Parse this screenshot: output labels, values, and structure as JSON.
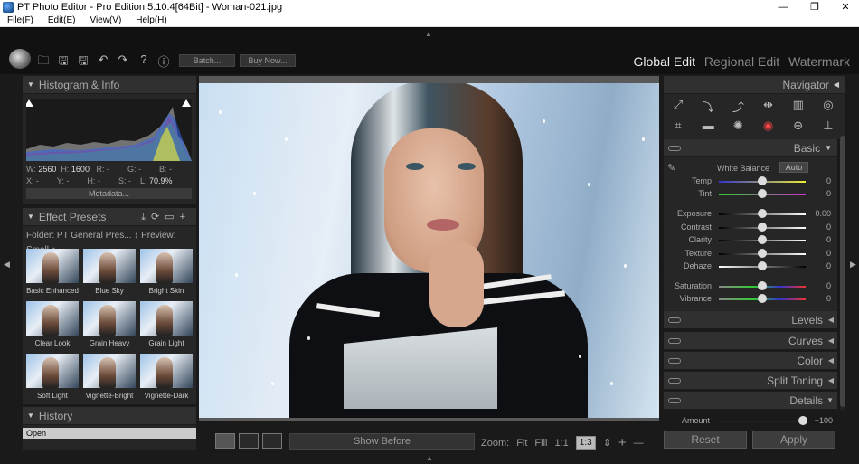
{
  "titlebar": {
    "title": "PT Photo Editor - Pro Edition 5.10.4[64Bit] - Woman-021.jpg",
    "min": "—",
    "max": "❐",
    "close": "✕"
  },
  "menu": [
    "File(F)",
    "Edit(E)",
    "View(V)",
    "Help(H)"
  ],
  "toolbar": {
    "batch_label": "Batch...",
    "buy_label": "Buy Now..."
  },
  "modes": {
    "global": "Global Edit",
    "regional": "Regional Edit",
    "watermark": "Watermark"
  },
  "histogram": {
    "title": "Histogram & Info",
    "w_label": "W:",
    "w": "2560",
    "h_label": "H:",
    "h": "1600",
    "r": "R:",
    "r_val": "-",
    "g": "G:",
    "g_val": "-",
    "b": "B:",
    "b_val": "-",
    "x": "X:",
    "x_val": "-",
    "y": "Y:",
    "y_val": "-",
    "hh": "H:",
    "hh_val": "-",
    "s": "S:",
    "s_val": "-",
    "l": "L:",
    "l_val": "70.9%",
    "metadata_label": "Metadata..."
  },
  "presets": {
    "title": "Effect Presets",
    "folder_text": "Folder:  PT General Pres... ↕ Preview:  Small ↕",
    "items": [
      "Basic Enhanced",
      "Blue Sky",
      "Bright Skin",
      "Clear Look",
      "Grain Heavy",
      "Grain Light",
      "Soft Light",
      "Vignette-Bright",
      "Vignette-Dark"
    ]
  },
  "history": {
    "title": "History",
    "items": [
      "Open"
    ]
  },
  "bottom": {
    "show_before": "Show Before",
    "zoom_label": "Zoom:",
    "fit": "Fit",
    "fill": "Fill",
    "one": "1:1",
    "ratio": "1:3",
    "plus": "+",
    "minus": "—"
  },
  "navigator": {
    "title": "Navigator"
  },
  "basic": {
    "title": "Basic",
    "wb_label": "White Balance",
    "auto_label": "Auto",
    "sliders": [
      {
        "name": "Temp",
        "value": "0",
        "level": 0.5
      },
      {
        "name": "Tint",
        "value": "0",
        "level": 0.5
      },
      {
        "name": "Exposure",
        "value": "0.00",
        "level": 0.5
      },
      {
        "name": "Contrast",
        "value": "0",
        "level": 0.5
      },
      {
        "name": "Clarity",
        "value": "0",
        "level": 0.5
      },
      {
        "name": "Texture",
        "value": "0",
        "level": 0.5
      },
      {
        "name": "Dehaze",
        "value": "0",
        "level": 0.5
      },
      {
        "name": "Saturation",
        "value": "0",
        "level": 0.5
      },
      {
        "name": "Vibrance",
        "value": "0",
        "level": 0.5
      }
    ]
  },
  "sections": [
    "Levels",
    "Curves",
    "Color",
    "Split Toning",
    "Details"
  ],
  "amount": {
    "label": "Amount",
    "value": "+100",
    "level": 0.95
  },
  "actions": {
    "reset": "Reset",
    "apply": "Apply"
  }
}
